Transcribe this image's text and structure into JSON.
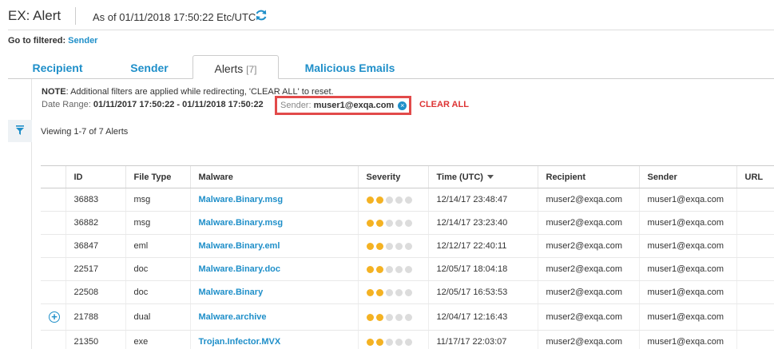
{
  "header": {
    "title": "EX: Alert",
    "as_of": "As of 01/11/2018 17:50:22 Etc/UTC"
  },
  "goto": {
    "label": "Go to filtered:",
    "link": "Sender"
  },
  "tabs": [
    {
      "label": "Recipient"
    },
    {
      "label": "Sender"
    },
    {
      "label": "Alerts",
      "count": "[7]"
    },
    {
      "label": "Malicious Emails"
    }
  ],
  "filters": {
    "note_label": "NOTE",
    "note_text": ": Additional filters are applied while redirecting, 'CLEAR ALL' to reset.",
    "date_range_label": "Date Range:",
    "date_range_value": "01/11/2017 17:50:22 - 01/11/2018 17:50:22",
    "sender_label": "Sender:",
    "sender_value": "muser1@exqa.com",
    "clear_all": "CLEAR ALL"
  },
  "viewing": "Viewing 1-7 of 7 Alerts",
  "table": {
    "columns": [
      "ID",
      "File Type",
      "Malware",
      "Severity",
      "Time (UTC)",
      "Recipient",
      "Sender",
      "URL"
    ],
    "rows": [
      {
        "id": "36883",
        "file_type": "msg",
        "malware": "Malware.Binary.msg",
        "severity": 2,
        "time": "12/14/17 23:48:47",
        "recipient": "muser2@exqa.com",
        "sender": "muser1@exqa.com",
        "expandable": false
      },
      {
        "id": "36882",
        "file_type": "msg",
        "malware": "Malware.Binary.msg",
        "severity": 2,
        "time": "12/14/17 23:23:40",
        "recipient": "muser2@exqa.com",
        "sender": "muser1@exqa.com",
        "expandable": false
      },
      {
        "id": "36847",
        "file_type": "eml",
        "malware": "Malware.Binary.eml",
        "severity": 2,
        "time": "12/12/17 22:40:11",
        "recipient": "muser2@exqa.com",
        "sender": "muser1@exqa.com",
        "expandable": false
      },
      {
        "id": "22517",
        "file_type": "doc",
        "malware": "Malware.Binary.doc",
        "severity": 2,
        "time": "12/05/17 18:04:18",
        "recipient": "muser2@exqa.com",
        "sender": "muser1@exqa.com",
        "expandable": false
      },
      {
        "id": "22508",
        "file_type": "doc",
        "malware": "Malware.Binary",
        "severity": 2,
        "time": "12/05/17 16:53:53",
        "recipient": "muser2@exqa.com",
        "sender": "muser1@exqa.com",
        "expandable": false
      },
      {
        "id": "21788",
        "file_type": "dual",
        "malware": "Malware.archive",
        "severity": 2,
        "time": "12/04/17 12:16:43",
        "recipient": "muser2@exqa.com",
        "sender": "muser1@exqa.com",
        "expandable": true
      },
      {
        "id": "21350",
        "file_type": "exe",
        "malware": "Trojan.Infector.MVX",
        "severity": 2,
        "time": "11/17/17 22:03:07",
        "recipient": "muser2@exqa.com",
        "sender": "muser1@exqa.com",
        "expandable": false
      }
    ],
    "severity_max": 5
  },
  "colors": {
    "link": "#1f8fc9",
    "severity_on": "#f4b223",
    "severity_off": "#dcdcdc",
    "highlight": "#e24a4a",
    "clear_all": "#d33333"
  },
  "icons": {
    "refresh": "refresh-icon",
    "filter": "filter-icon",
    "remove": "remove-filter-icon",
    "expand": "expand-row-icon",
    "sort": "sort-desc-icon"
  }
}
